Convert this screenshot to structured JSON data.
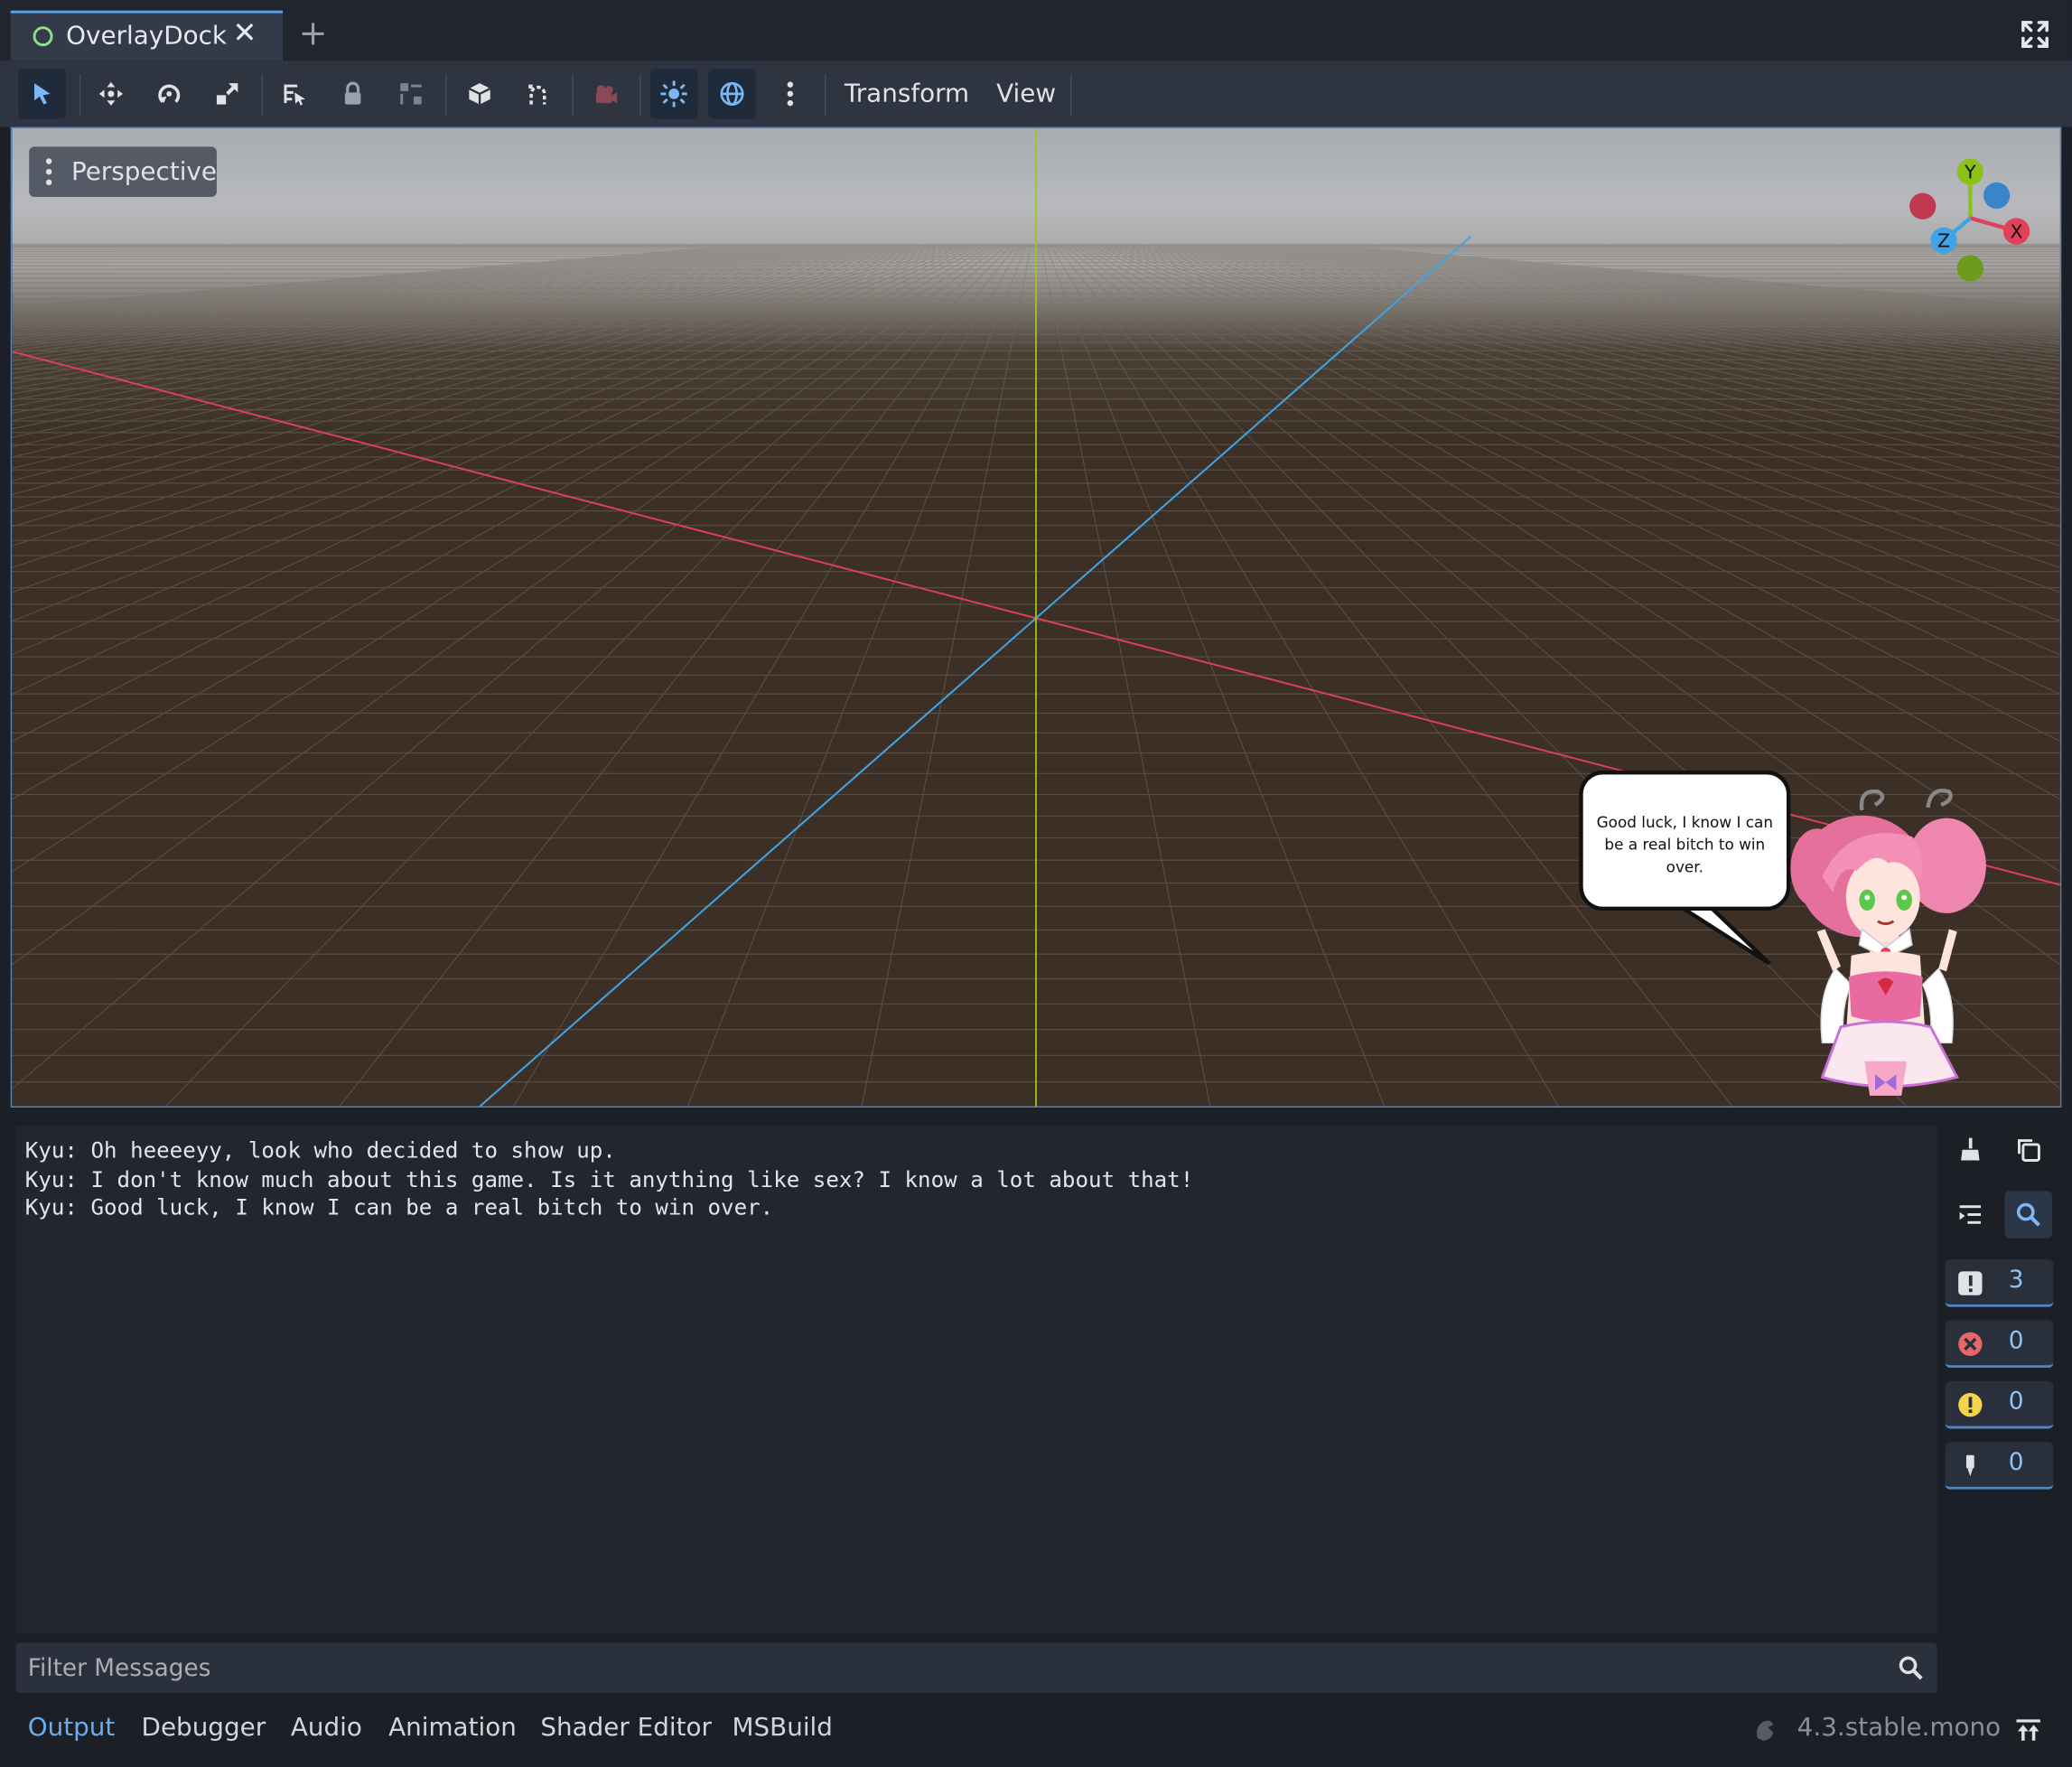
{
  "tabs": [
    {
      "label": "OverlayDock",
      "active": true
    }
  ],
  "toolbar": {
    "tools": [
      "select-tool",
      "move-tool",
      "rotate-tool",
      "scale-tool",
      "list-select-tool",
      "lock-tool",
      "group-tool",
      "local-space-tool",
      "snap-tool",
      "camera-preview-tool",
      "sun-preview-toggle",
      "environment-preview-toggle",
      "more-options"
    ],
    "transform_menu": "Transform",
    "view_menu": "View"
  },
  "viewport": {
    "mode_label": "Perspective",
    "gizmo": {
      "y": "Y",
      "x": "X",
      "z": "Z"
    },
    "colors": {
      "x_axis": "#e0405a",
      "y_axis": "#a2c520",
      "z_axis": "#3fa3e6",
      "ground": "#3c3026"
    }
  },
  "overlay": {
    "speech": "Good luck, I know I can be a real bitch to win over."
  },
  "output": {
    "lines": [
      "Kyu: Oh heeeeyy, look who decided to show up.",
      "Kyu: I don't know much about this game. Is it anything like sex? I know a lot about that!",
      "Kyu: Good luck, I know I can be a real bitch to win over."
    ],
    "counters": {
      "messages": "3",
      "errors": "0",
      "warnings": "0",
      "editor": "0"
    },
    "filter_placeholder": "Filter Messages"
  },
  "bottom_tabs": [
    "Output",
    "Debugger",
    "Audio",
    "Animation",
    "Shader Editor",
    "MSBuild"
  ],
  "version": "4.3.stable.mono",
  "colors": {
    "accent": "#57a3e8",
    "panel": "#212631"
  }
}
